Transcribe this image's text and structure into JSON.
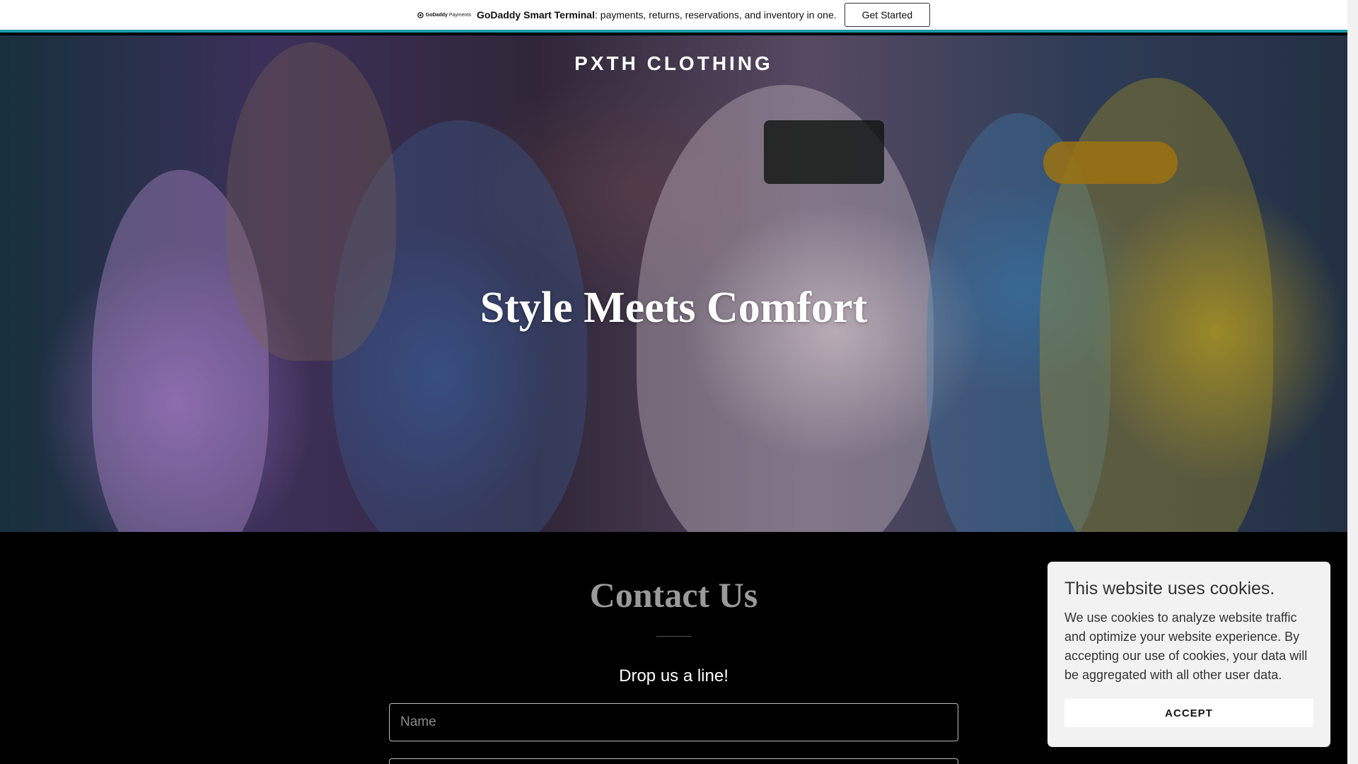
{
  "promo": {
    "logo_name": "GoDaddy",
    "logo_suffix": "Payments",
    "product": "GoDaddy Smart Terminal",
    "text": ": payments, returns, reservations, and inventory in one.",
    "button_label": "Get Started",
    "accent_color": "#1a9ba8"
  },
  "header": {
    "brand": "PXTH CLOTHING"
  },
  "hero": {
    "title": "Style Meets Comfort"
  },
  "contact": {
    "title": "Contact Us",
    "subtitle": "Drop us a line!",
    "name_placeholder": "Name",
    "email_placeholder": ""
  },
  "cookie": {
    "title": "This website uses cookies.",
    "text": "We use cookies to analyze website traffic and optimize your website experience. By accepting our use of cookies, your data will be aggregated with all other user data.",
    "accept_label": "ACCEPT"
  }
}
